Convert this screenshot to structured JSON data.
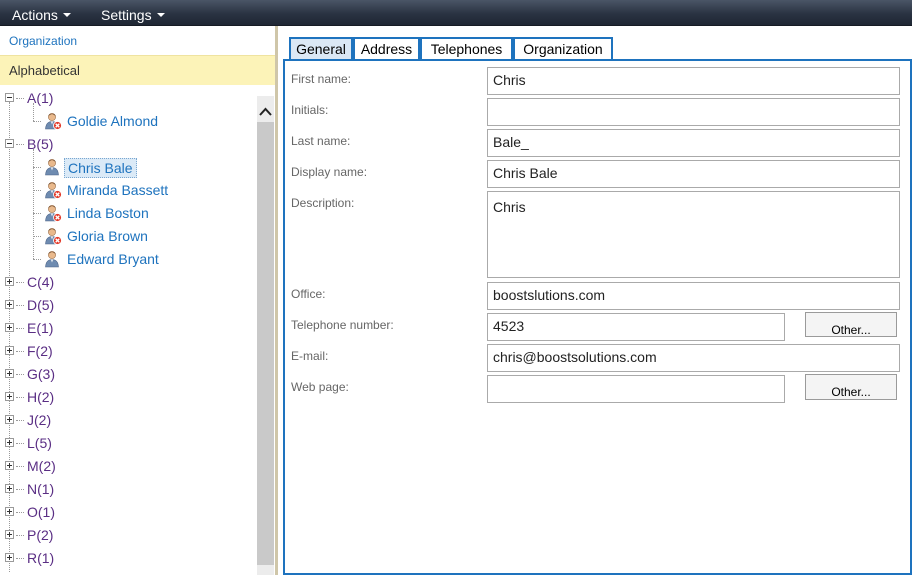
{
  "menu": {
    "actions_label": "Actions",
    "settings_label": "Settings"
  },
  "left_panel": {
    "organization_link": "Organization",
    "alphabetical_label": "Alphabetical",
    "groups": [
      {
        "label": "A(1)",
        "expanded": true,
        "members": [
          {
            "name": "Goldie Almond",
            "status": "disabled"
          }
        ]
      },
      {
        "label": "B(5)",
        "expanded": true,
        "members": [
          {
            "name": "Chris Bale",
            "status": "active",
            "selected": true
          },
          {
            "name": "Miranda Bassett",
            "status": "disabled"
          },
          {
            "name": "Linda Boston",
            "status": "disabled"
          },
          {
            "name": "Gloria Brown",
            "status": "disabled"
          },
          {
            "name": "Edward Bryant",
            "status": "active"
          }
        ]
      },
      {
        "label": "C(4)",
        "expanded": false
      },
      {
        "label": "D(5)",
        "expanded": false
      },
      {
        "label": "E(1)",
        "expanded": false
      },
      {
        "label": "F(2)",
        "expanded": false
      },
      {
        "label": "G(3)",
        "expanded": false
      },
      {
        "label": "H(2)",
        "expanded": false
      },
      {
        "label": "J(2)",
        "expanded": false
      },
      {
        "label": "L(5)",
        "expanded": false
      },
      {
        "label": "M(2)",
        "expanded": false
      },
      {
        "label": "N(1)",
        "expanded": false
      },
      {
        "label": "O(1)",
        "expanded": false
      },
      {
        "label": "P(2)",
        "expanded": false
      },
      {
        "label": "R(1)",
        "expanded": false
      }
    ]
  },
  "tabs": [
    "General",
    "Address",
    "Telephones",
    "Organization"
  ],
  "active_tab": "General",
  "form": {
    "first_name_label": "First name:",
    "first_name_value": "Chris",
    "initials_label": "Initials:",
    "initials_value": "",
    "last_name_label": "Last name:",
    "last_name_value": "Bale_",
    "display_name_label": "Display name:",
    "display_name_value": "Chris Bale",
    "description_label": "Description:",
    "description_value": "Chris",
    "office_label": "Office:",
    "office_value": "boostslutions.com",
    "telephone_label": "Telephone number:",
    "telephone_value": "4523",
    "telephone_other_label": "Other...",
    "email_label": "E-mail:",
    "email_value": "chris@boostsolutions.com",
    "webpage_label": "Web page:",
    "webpage_value": "",
    "webpage_other_label": "Other..."
  },
  "colors": {
    "accent": "#1e73be",
    "group_text": "#5a2e84",
    "alphabetical_bg": "#fcf3b8",
    "menubar": "#2a3342"
  }
}
